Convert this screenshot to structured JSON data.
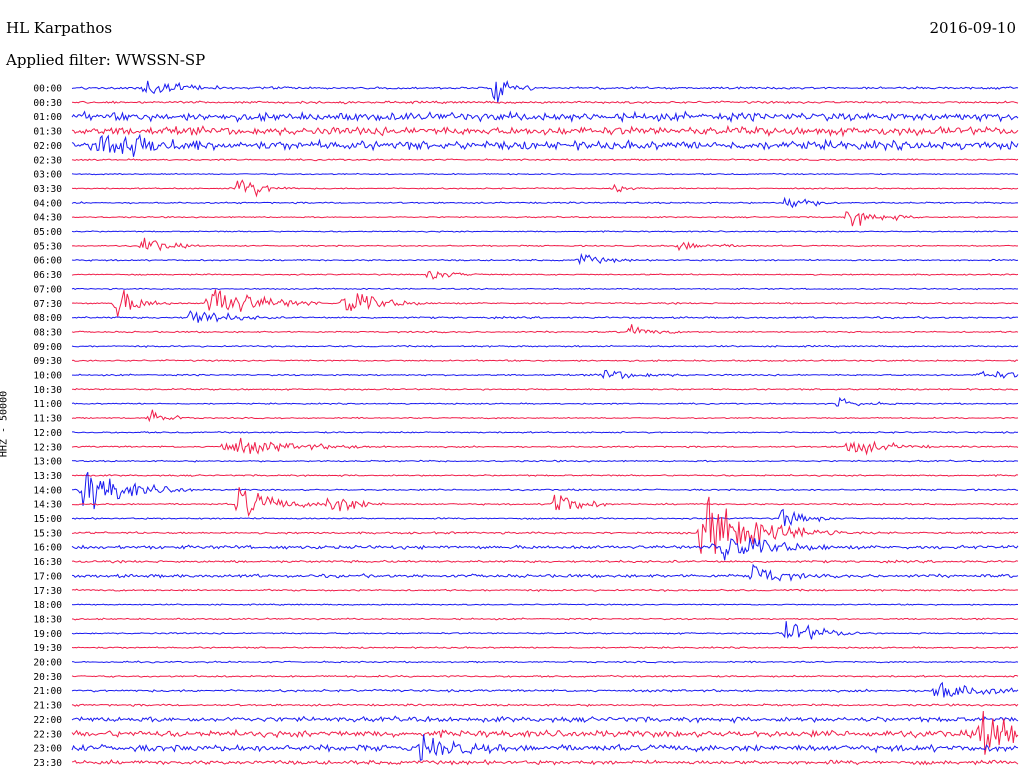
{
  "header": {
    "station": "HL Karpathos",
    "date": "2016-09-10",
    "filter": "Applied filter: WWSSN-SP"
  },
  "chart_data": {
    "type": "line",
    "title": "HL Karpathos",
    "subtitle": "Applied filter: WWSSN-SP",
    "ylabel": "HHZ - 50000",
    "xlabel": "",
    "colors": [
      "#1a1af0",
      "#f01e4a"
    ],
    "grid": false,
    "row_labels": [
      "00:00",
      "00:30",
      "01:00",
      "01:30",
      "02:00",
      "02:30",
      "03:00",
      "03:30",
      "04:00",
      "04:30",
      "05:00",
      "05:30",
      "06:00",
      "06:30",
      "07:00",
      "07:30",
      "08:00",
      "08:30",
      "09:00",
      "09:30",
      "10:00",
      "10:30",
      "11:00",
      "11:30",
      "12:00",
      "12:30",
      "13:00",
      "13:30",
      "14:00",
      "14:30",
      "15:00",
      "15:30",
      "16:00",
      "16:30",
      "17:00",
      "17:30",
      "18:00",
      "18:30",
      "19:00",
      "19:30",
      "20:00",
      "20:30",
      "21:00",
      "21:30",
      "22:00",
      "22:30",
      "23:00",
      "23:30"
    ],
    "row_noise": [
      0.9,
      0.9,
      3.2,
      3.2,
      3.4,
      0.6,
      0.5,
      0.5,
      0.6,
      0.5,
      0.5,
      0.5,
      0.6,
      0.5,
      0.5,
      0.6,
      0.7,
      0.6,
      0.6,
      0.6,
      0.6,
      0.6,
      0.5,
      0.5,
      0.6,
      0.6,
      0.6,
      0.6,
      0.6,
      0.6,
      0.6,
      0.8,
      1.4,
      0.9,
      1.3,
      0.7,
      0.5,
      0.6,
      0.6,
      0.6,
      0.6,
      0.7,
      0.9,
      0.8,
      2.0,
      2.6,
      2.6,
      1.6
    ],
    "events": [
      {
        "row": 0,
        "x": 0.078,
        "amp": 10,
        "len": 0.03
      },
      {
        "row": 0,
        "x": 0.447,
        "amp": 13,
        "len": 0.015
      },
      {
        "row": 4,
        "x": 0.03,
        "amp": 16,
        "len": 0.04
      },
      {
        "row": 7,
        "x": 0.175,
        "amp": 14,
        "len": 0.02
      },
      {
        "row": 7,
        "x": 0.575,
        "amp": 4,
        "len": 0.01
      },
      {
        "row": 8,
        "x": 0.754,
        "amp": 8,
        "len": 0.02
      },
      {
        "row": 9,
        "x": 0.82,
        "amp": 8,
        "len": 0.03
      },
      {
        "row": 11,
        "x": 0.075,
        "amp": 9,
        "len": 0.02
      },
      {
        "row": 11,
        "x": 0.64,
        "amp": 4,
        "len": 0.03
      },
      {
        "row": 12,
        "x": 0.537,
        "amp": 6,
        "len": 0.02
      },
      {
        "row": 13,
        "x": 0.378,
        "amp": 5,
        "len": 0.02
      },
      {
        "row": 15,
        "x": 0.045,
        "amp": 16,
        "len": 0.02
      },
      {
        "row": 15,
        "x": 0.145,
        "amp": 20,
        "len": 0.04
      },
      {
        "row": 15,
        "x": 0.287,
        "amp": 14,
        "len": 0.03
      },
      {
        "row": 16,
        "x": 0.125,
        "amp": 9,
        "len": 0.03
      },
      {
        "row": 17,
        "x": 0.59,
        "amp": 5,
        "len": 0.02
      },
      {
        "row": 20,
        "x": 0.56,
        "amp": 6,
        "len": 0.03
      },
      {
        "row": 20,
        "x": 0.96,
        "amp": 4,
        "len": 0.04
      },
      {
        "row": 22,
        "x": 0.81,
        "amp": 5,
        "len": 0.02
      },
      {
        "row": 23,
        "x": 0.082,
        "amp": 8,
        "len": 0.015
      },
      {
        "row": 25,
        "x": 0.16,
        "amp": 8,
        "len": 0.06
      },
      {
        "row": 25,
        "x": 0.82,
        "amp": 9,
        "len": 0.03
      },
      {
        "row": 28,
        "x": 0.01,
        "amp": 20,
        "len": 0.04
      },
      {
        "row": 29,
        "x": 0.175,
        "amp": 18,
        "len": 0.03
      },
      {
        "row": 29,
        "x": 0.27,
        "amp": 15,
        "len": 0.02
      },
      {
        "row": 29,
        "x": 0.51,
        "amp": 16,
        "len": 0.02
      },
      {
        "row": 30,
        "x": 0.75,
        "amp": 9,
        "len": 0.02
      },
      {
        "row": 31,
        "x": 0.665,
        "amp": 30,
        "len": 0.05
      },
      {
        "row": 32,
        "x": 0.68,
        "amp": 18,
        "len": 0.04
      },
      {
        "row": 34,
        "x": 0.72,
        "amp": 12,
        "len": 0.02
      },
      {
        "row": 38,
        "x": 0.755,
        "amp": 12,
        "len": 0.03
      },
      {
        "row": 42,
        "x": 0.91,
        "amp": 10,
        "len": 0.04
      },
      {
        "row": 45,
        "x": 0.96,
        "amp": 22,
        "len": 0.04
      },
      {
        "row": 46,
        "x": 0.37,
        "amp": 10,
        "len": 0.03
      }
    ]
  }
}
